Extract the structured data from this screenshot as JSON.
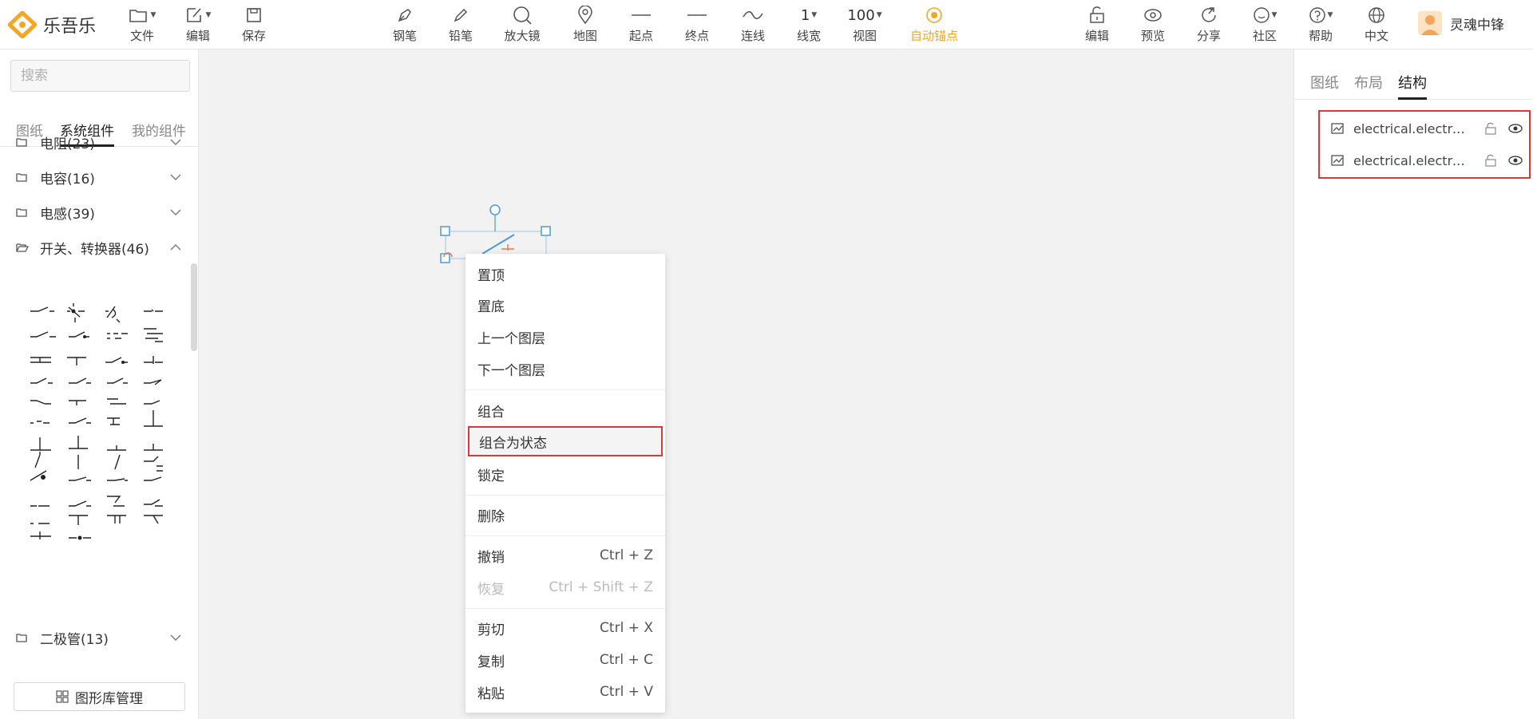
{
  "app": {
    "name": "乐吾乐"
  },
  "toolbar": {
    "left": [
      {
        "label": "文件",
        "icon": "folder-icon"
      },
      {
        "label": "编辑",
        "icon": "edit-icon"
      },
      {
        "label": "保存",
        "icon": "save-icon"
      }
    ],
    "center": [
      {
        "label": "钢笔",
        "icon": "pen-icon"
      },
      {
        "label": "铅笔",
        "icon": "pencil-icon"
      },
      {
        "label": "放大镜",
        "icon": "magnifier-icon"
      },
      {
        "label": "地图",
        "icon": "map-pin-icon"
      },
      {
        "label": "起点",
        "icon": "start-point-icon"
      },
      {
        "label": "终点",
        "icon": "end-point-icon"
      },
      {
        "label": "连线",
        "icon": "curve-line-icon"
      },
      {
        "label": "线宽",
        "value": "1"
      },
      {
        "label": "视图",
        "value": "100"
      },
      {
        "label": "自动锚点",
        "icon": "anchor-icon",
        "active": true
      }
    ],
    "right": [
      {
        "label": "编辑",
        "icon": "lock-icon"
      },
      {
        "label": "预览",
        "icon": "eye-icon"
      },
      {
        "label": "分享",
        "icon": "share-icon"
      },
      {
        "label": "社区",
        "icon": "community-icon"
      },
      {
        "label": "帮助",
        "icon": "help-icon"
      },
      {
        "label": "中文",
        "icon": "globe-icon"
      }
    ],
    "user": {
      "name": "灵魂中锋"
    },
    "accent": "#f5a623"
  },
  "sidebar": {
    "search_placeholder": "搜索",
    "tabs": [
      "图纸",
      "系统组件",
      "我的组件"
    ],
    "active_tab": 1,
    "categories": [
      {
        "label": "电阻(23)",
        "expanded": false
      },
      {
        "label": "电容(16)",
        "expanded": false
      },
      {
        "label": "电感(39)",
        "expanded": false
      },
      {
        "label": "开关、转换器(46)",
        "expanded": true
      },
      {
        "label": "二极管(13)",
        "expanded": false
      }
    ],
    "library_button": "图形库管理"
  },
  "context_menu": {
    "items": [
      {
        "label": "置顶",
        "shortcut": ""
      },
      {
        "label": "置底",
        "shortcut": ""
      },
      {
        "label": "上一个图层",
        "shortcut": ""
      },
      {
        "label": "下一个图层",
        "shortcut": ""
      },
      {
        "label": "组合",
        "shortcut": ""
      },
      {
        "label": "组合为状态",
        "shortcut": "",
        "highlighted": true
      },
      {
        "label": "锁定",
        "shortcut": ""
      },
      {
        "label": "删除",
        "shortcut": ""
      },
      {
        "label": "撤销",
        "shortcut": "Ctrl + Z"
      },
      {
        "label": "恢复",
        "shortcut": "Ctrl + Shift + Z",
        "disabled": true
      },
      {
        "label": "剪切",
        "shortcut": "Ctrl + X"
      },
      {
        "label": "复制",
        "shortcut": "Ctrl + C"
      },
      {
        "label": "粘贴",
        "shortcut": "Ctrl + V"
      }
    ],
    "highlight_color": "#d63b3b"
  },
  "right_panel": {
    "tabs": [
      "图纸",
      "布局",
      "结构"
    ],
    "active_tab": 2,
    "nodes": [
      {
        "label": "electrical.electro..."
      },
      {
        "label": "electrical.electro..."
      }
    ]
  }
}
